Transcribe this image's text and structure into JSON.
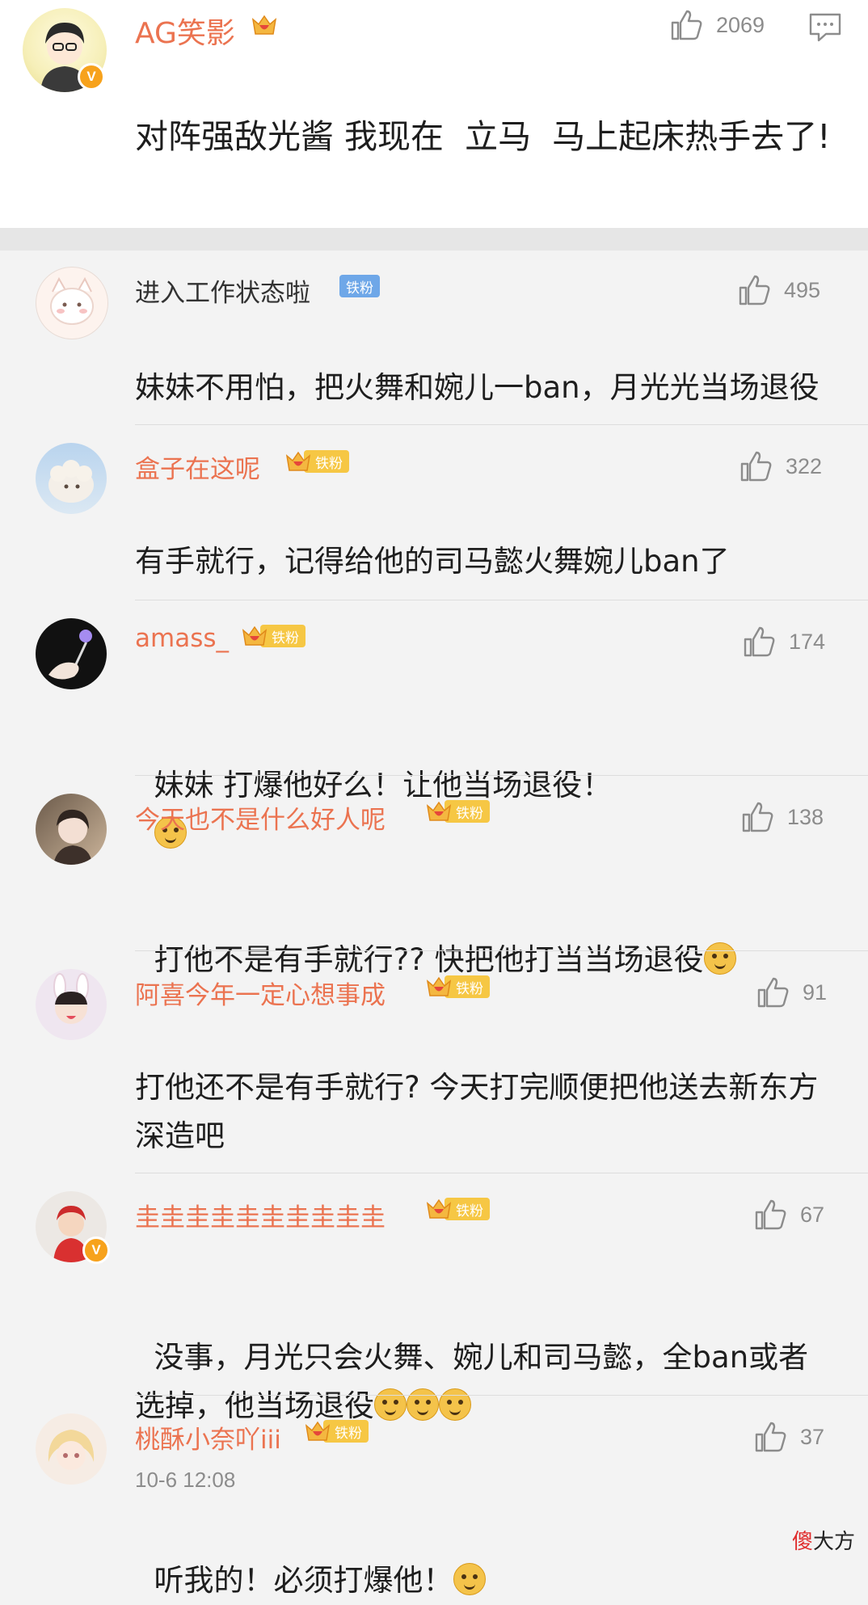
{
  "top_comment": {
    "username": "AG笑影",
    "likes": "2069",
    "text": "对阵强敌光酱 我现在  立马  马上起床热手去了!",
    "verified": "V"
  },
  "replies": [
    {
      "username": "进入工作状态啦",
      "badge": "铁粉",
      "likes": "495",
      "text": "妹妹不用怕，把火舞和婉儿一ban，月光光当场退役"
    },
    {
      "username": "盒子在这呢",
      "badge": "铁粉",
      "likes": "322",
      "text": "有手就行，记得给他的司马懿火舞婉儿ban了"
    },
    {
      "username": "amass_",
      "badge": "铁粉",
      "likes": "174",
      "text": "妹妹 打爆他好么！让他当场退役！"
    },
    {
      "username": "今天也不是什么好人呢",
      "badge": "铁粉",
      "likes": "138",
      "text": "打他不是有手就行?? 快把他打当当场退役"
    },
    {
      "username": "阿喜今年一定心想事成",
      "badge": "铁粉",
      "likes": "91",
      "text": "打他还不是有手就行? 今天打完顺便把他送去新东方深造吧"
    },
    {
      "username": "圭圭圭圭圭圭圭圭圭圭",
      "badge": "铁粉",
      "likes": "67",
      "text": "没事，月光只会火舞、婉儿和司马懿，全ban或者选掉，他当场退役",
      "verified": "V"
    },
    {
      "username": "桃酥小奈吖iii",
      "badge": "铁粉",
      "likes": "37",
      "timestamp": "10-6 12:08",
      "text": "听我的！必须打爆他！"
    }
  ],
  "watermark": {
    "part1": "傻",
    "part2": "大方"
  },
  "colors": {
    "name": "#eb7350",
    "badge": "#f6c744",
    "badge_blue": "#6ea7e8",
    "verified": "#f7a21c"
  },
  "icons": [
    "thumbs-up-icon",
    "comment-icon",
    "crown-icon",
    "emoji-icon"
  ]
}
